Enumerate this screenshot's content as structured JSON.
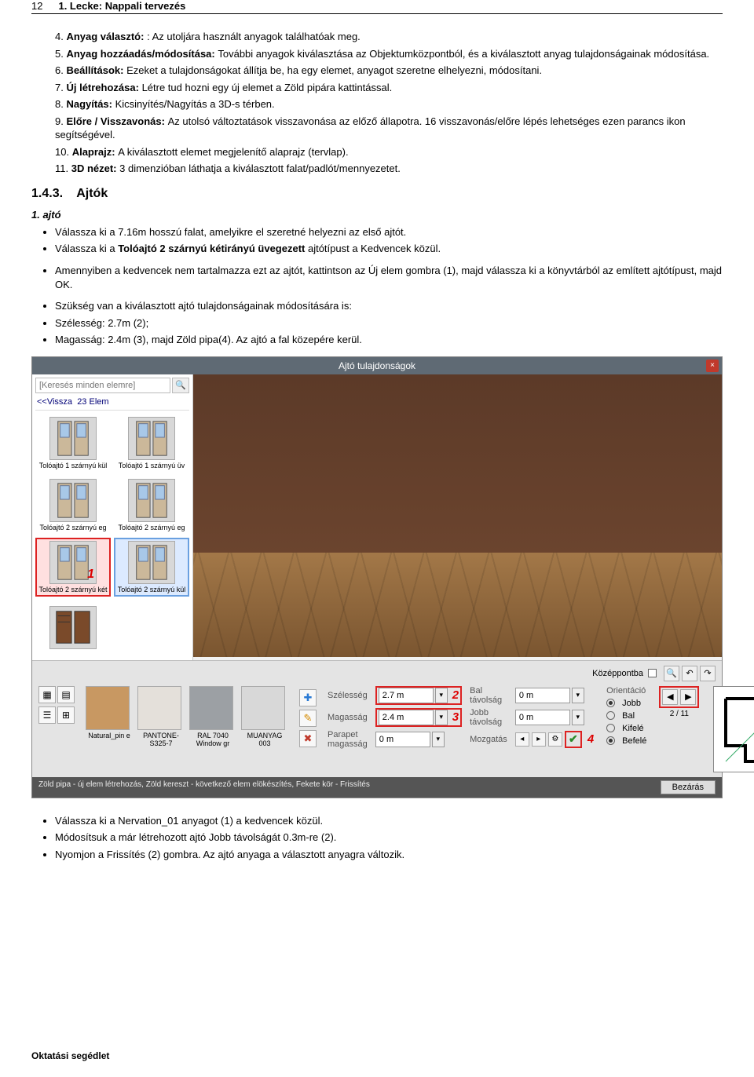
{
  "header": {
    "page_num": "12",
    "title": "1. Lecke: Nappali tervezés"
  },
  "list": [
    {
      "n": "4",
      "label": "Anyag választó: ",
      "text": ": Az utoljára használt anyagok találhatóak meg."
    },
    {
      "n": "5",
      "label": "Anyag hozzáadás/módosítása: ",
      "text": "További anyagok kiválasztása az Objektumközpontból, és a kiválasztott anyag tulajdonságainak módosítása."
    },
    {
      "n": "6",
      "label": "Beállítások: ",
      "text": "Ezeket a tulajdonságokat állítja be, ha egy elemet, anyagot szeretne elhelyezni, módosítani."
    },
    {
      "n": "7",
      "label": "Új létrehozása: ",
      "text": "Létre tud hozni egy új elemet a Zöld pipára kattintással."
    },
    {
      "n": "8",
      "label": "Nagyítás: ",
      "text": "Kicsinyítés/Nagyítás a 3D-s térben."
    },
    {
      "n": "9",
      "label": "Előre / Visszavonás: ",
      "text": "Az utolsó változtatások visszavonása az előző állapotra. 16 visszavonás/előre lépés lehetséges ezen parancs ikon segítségével."
    },
    {
      "n": "10",
      "label": "Alaprajz: ",
      "text": "A kiválasztott elemet megjelenítő alaprajz (tervlap)."
    },
    {
      "n": "11",
      "label": "3D nézet: ",
      "text": "3 dimenzióban láthatja a kiválasztott falat/padlót/mennyezetet."
    }
  ],
  "section": {
    "num": "1.4.3.",
    "title": "Ajtók"
  },
  "sub": "1. ajtó",
  "b1": [
    "Válassza ki a 7.16m hosszú falat, amelyikre el szeretné helyezni az első ajtót.",
    {
      "pre": "Válassza ki a ",
      "bold": "Tolóajtó 2 szárnyú kétirányú üvegezett",
      "post": " ajtótípust a Kedvencek közül."
    }
  ],
  "b2": [
    "Amennyiben a kedvencek nem tartalmazza ezt az ajtót, kattintson az Új elem gombra (1), majd válassza ki a könyvtárból az említett ajtótípust, majd OK."
  ],
  "b3": [
    "Szükség van a kiválasztott ajtó tulajdonságainak módosítására is:",
    "Szélesség: 2.7m (2);",
    "Magasság: 2.4m (3), majd Zöld pipa(4). Az ajtó a fal közepére kerül."
  ],
  "dialog": {
    "title": "Ajtó tulajdonságok",
    "search_placeholder": "[Keresés minden elemre]",
    "back": "<<Vissza",
    "count": "23 Elem",
    "doors": [
      {
        "name": "Tolóajtó 1 szárnyú kül"
      },
      {
        "name": "Tolóajtó 1 szárnyú üv"
      },
      {
        "name": "Tolóajtó 2 szárnyú eg"
      },
      {
        "name": "Tolóajtó 2 szárnyú eg"
      },
      {
        "name": "Tolóajtó 2 szárnyú két",
        "selected": true,
        "num": "1"
      },
      {
        "name": "Tolóajtó 2 szárnyú kül",
        "hover": true
      }
    ],
    "materials": [
      {
        "name": "Natural_pin e",
        "color": "#c89862"
      },
      {
        "name": "PANTONE-S325-7",
        "color": "#e4e0da"
      },
      {
        "name": "RAL 7040 Window gr",
        "color": "#9ca0a4"
      },
      {
        "name": "MUANYAG 003",
        "color": "#d8d8d8"
      }
    ],
    "kozepponta": "Középpontba",
    "props": {
      "szelesseg_l": "Szélesség",
      "szelesseg_v": "2.7 m",
      "szelesseg_n": "2",
      "magassag_l": "Magasság",
      "magassag_v": "2.4 m",
      "magassag_n": "3",
      "parapet_l": "Parapet magasság",
      "parapet_v": "0 m",
      "balt_l": "Bal távolság",
      "balt_v": "0 m",
      "jobbt_l": "Jobb távolság",
      "jobbt_v": "0 m",
      "mozg_l": "Mozgatás",
      "orient_l": "Orientáció",
      "jobb": "Jobb",
      "bal": "Bal",
      "kifele": "Kifelé",
      "befele": "Befelé",
      "orient_count": "2 / 11",
      "green_n": "4"
    },
    "hint": "Zöld pipa - új elem létrehozás, Zöld kereszt - következő elem elökészítés, Fekete kör - Frissítés",
    "close": "Bezárás"
  },
  "b4": [
    "Válassza ki a Nervation_01 anyagot (1) a kedvencek közül.",
    "Módosítsuk a már létrehozott ajtó Jobb távolságát 0.3m-re (2).",
    "Nyomjon a Frissítés (2) gombra. Az ajtó anyaga a választott anyagra változik."
  ],
  "footer": "Oktatási segédlet"
}
